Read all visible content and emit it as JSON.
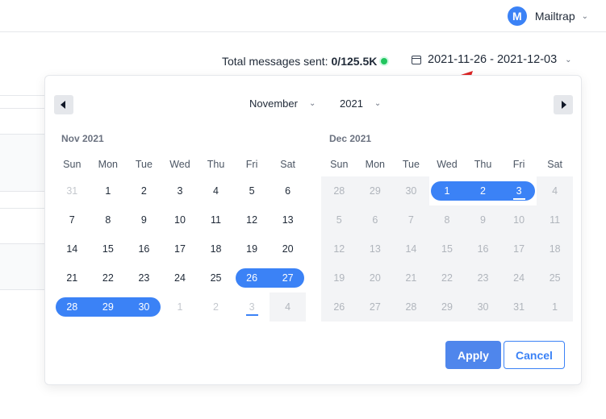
{
  "header": {
    "account_initial": "M",
    "account_name": "Mailtrap"
  },
  "stats": {
    "label": "Total messages sent:",
    "value": "0/125.5K",
    "status_color": "#22c55e"
  },
  "date_range": {
    "value": "2021-11-26 - 2021-12-03"
  },
  "picker": {
    "month_select": "November",
    "year_select": "2021",
    "weekdays": [
      "Sun",
      "Mon",
      "Tue",
      "Wed",
      "Thu",
      "Fri",
      "Sat"
    ],
    "left_title": "Nov 2021",
    "right_title": "Dec 2021",
    "left_weeks": [
      [
        {
          "d": "31",
          "s": "muted"
        },
        {
          "d": "1"
        },
        {
          "d": "2"
        },
        {
          "d": "3"
        },
        {
          "d": "4"
        },
        {
          "d": "5"
        },
        {
          "d": "6"
        }
      ],
      [
        {
          "d": "7"
        },
        {
          "d": "8"
        },
        {
          "d": "9"
        },
        {
          "d": "10"
        },
        {
          "d": "11"
        },
        {
          "d": "12"
        },
        {
          "d": "13"
        }
      ],
      [
        {
          "d": "14"
        },
        {
          "d": "15"
        },
        {
          "d": "16"
        },
        {
          "d": "17"
        },
        {
          "d": "18"
        },
        {
          "d": "19"
        },
        {
          "d": "20"
        }
      ],
      [
        {
          "d": "21"
        },
        {
          "d": "22"
        },
        {
          "d": "23"
        },
        {
          "d": "24"
        },
        {
          "d": "25"
        },
        {
          "d": "26",
          "s": "sel-start"
        },
        {
          "d": "27",
          "s": "sel-end"
        }
      ],
      [
        {
          "d": "28",
          "s": "sel-start"
        },
        {
          "d": "29",
          "s": "sel-mid"
        },
        {
          "d": "30",
          "s": "sel-end"
        },
        {
          "d": "1",
          "s": "muted"
        },
        {
          "d": "2",
          "s": "muted"
        },
        {
          "d": "3",
          "s": "muted today"
        },
        {
          "d": "4",
          "s": "disabled"
        }
      ]
    ],
    "right_weeks": [
      [
        {
          "d": "28",
          "s": "disabled"
        },
        {
          "d": "29",
          "s": "disabled"
        },
        {
          "d": "30",
          "s": "disabled"
        },
        {
          "d": "1",
          "s": "sel-start"
        },
        {
          "d": "2",
          "s": "sel-mid"
        },
        {
          "d": "3",
          "s": "sel-end today"
        },
        {
          "d": "4",
          "s": "disabled"
        }
      ],
      [
        {
          "d": "5",
          "s": "disabled"
        },
        {
          "d": "6",
          "s": "disabled"
        },
        {
          "d": "7",
          "s": "disabled"
        },
        {
          "d": "8",
          "s": "disabled"
        },
        {
          "d": "9",
          "s": "disabled"
        },
        {
          "d": "10",
          "s": "disabled"
        },
        {
          "d": "11",
          "s": "disabled"
        }
      ],
      [
        {
          "d": "12",
          "s": "disabled"
        },
        {
          "d": "13",
          "s": "disabled"
        },
        {
          "d": "14",
          "s": "disabled"
        },
        {
          "d": "15",
          "s": "disabled"
        },
        {
          "d": "16",
          "s": "disabled"
        },
        {
          "d": "17",
          "s": "disabled"
        },
        {
          "d": "18",
          "s": "disabled"
        }
      ],
      [
        {
          "d": "19",
          "s": "disabled"
        },
        {
          "d": "20",
          "s": "disabled"
        },
        {
          "d": "21",
          "s": "disabled"
        },
        {
          "d": "22",
          "s": "disabled"
        },
        {
          "d": "23",
          "s": "disabled"
        },
        {
          "d": "24",
          "s": "disabled"
        },
        {
          "d": "25",
          "s": "disabled"
        }
      ],
      [
        {
          "d": "26",
          "s": "disabled"
        },
        {
          "d": "27",
          "s": "disabled"
        },
        {
          "d": "28",
          "s": "disabled"
        },
        {
          "d": "29",
          "s": "disabled"
        },
        {
          "d": "30",
          "s": "disabled"
        },
        {
          "d": "31",
          "s": "disabled"
        },
        {
          "d": "1",
          "s": "disabled"
        }
      ]
    ],
    "apply_label": "Apply",
    "cancel_label": "Cancel",
    "accent_color": "#3b82f6"
  },
  "icons": {
    "prev": "chevron-left-icon",
    "next": "chevron-right-icon",
    "calendar": "calendar-icon",
    "annotation": "red-arrow"
  }
}
